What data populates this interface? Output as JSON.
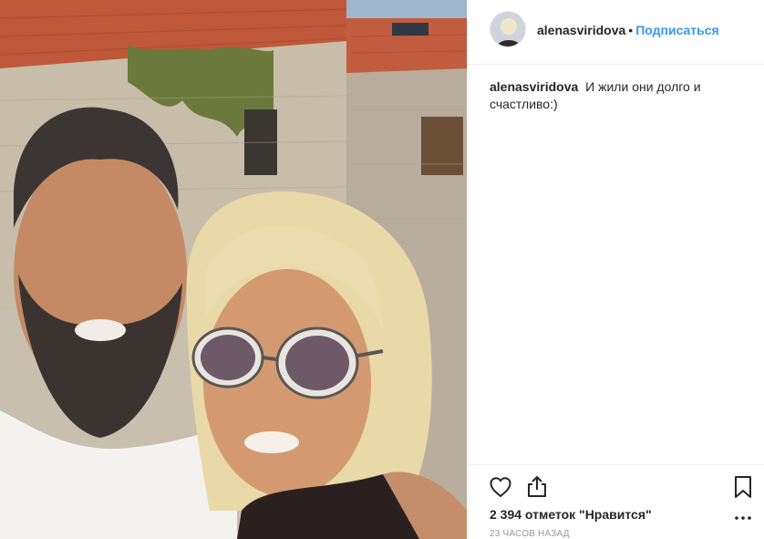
{
  "post": {
    "username": "alenasviridova",
    "separator": "•",
    "follow_label": "Подписаться",
    "caption_text": "И жили они долго и счастливо:)",
    "likes_text": "2 394 отметок \"Нравится\"",
    "timestamp": "23 часов назад"
  },
  "icons": {
    "like": "heart-outline-icon",
    "share": "share-icon",
    "save": "bookmark-icon",
    "more": "more-dots-icon"
  },
  "colors": {
    "accent": "#3897f0",
    "text": "#262626",
    "muted": "#999999",
    "divider": "#efefef"
  }
}
